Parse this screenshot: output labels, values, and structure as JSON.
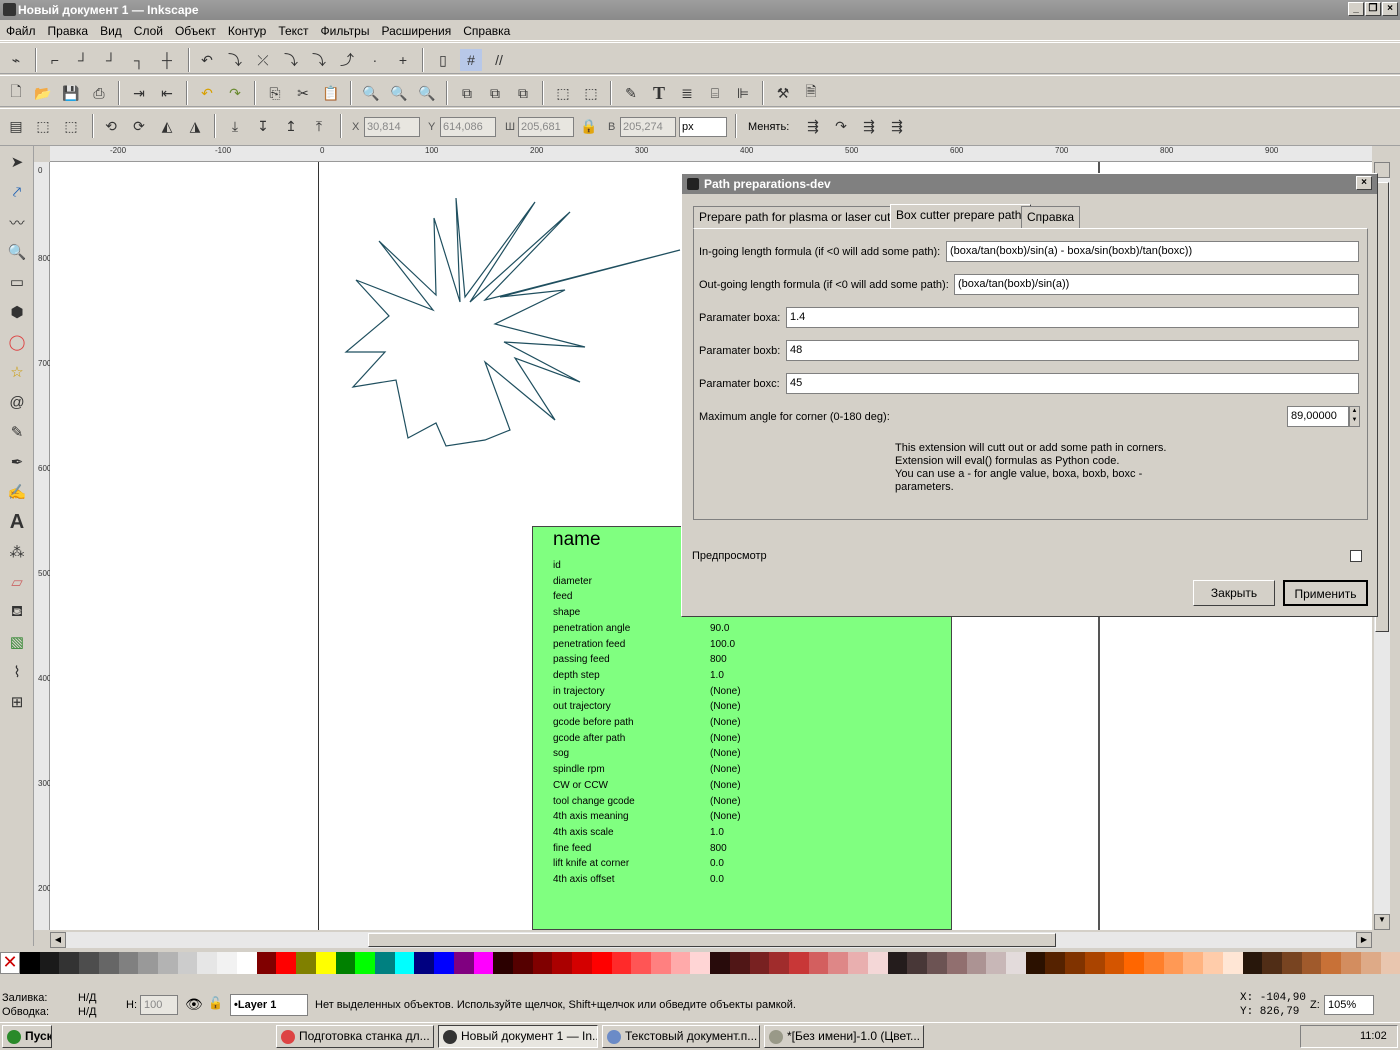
{
  "window": {
    "title": "Новый документ 1 — Inkscape"
  },
  "menu": [
    "Файл",
    "Правка",
    "Вид",
    "Слой",
    "Объект",
    "Контур",
    "Текст",
    "Фильтры",
    "Расширения",
    "Справка"
  ],
  "toolcontrols": {
    "x_label": "X",
    "x": "30,814",
    "y_label": "Y",
    "y": "614,086",
    "w_label": "Ш",
    "w": "205,681",
    "h_label": "В",
    "h": "205,274",
    "unit": "px",
    "change_label": "Менять:"
  },
  "ruler_h": [
    "-200",
    "-100",
    "0",
    "100",
    "200",
    "300",
    "400",
    "500",
    "600",
    "700",
    "800",
    "900"
  ],
  "ruler_v": [
    "0",
    "800",
    "700",
    "600",
    "500",
    "400",
    "300",
    "200"
  ],
  "green": {
    "title": "name",
    "rows": [
      {
        "k": "id",
        "v": ""
      },
      {
        "k": "diameter",
        "v": ""
      },
      {
        "k": "feed",
        "v": ""
      },
      {
        "k": "shape",
        "v": ""
      },
      {
        "k": "penetration angle",
        "v": "90.0"
      },
      {
        "k": "penetration feed",
        "v": "100.0"
      },
      {
        "k": "passing feed",
        "v": "800"
      },
      {
        "k": "depth step",
        "v": "1.0"
      },
      {
        "k": "in trajectory",
        "v": "(None)"
      },
      {
        "k": "out trajectory",
        "v": "(None)"
      },
      {
        "k": "gcode before path",
        "v": "(None)"
      },
      {
        "k": "gcode after path",
        "v": "(None)"
      },
      {
        "k": "sog",
        "v": "(None)"
      },
      {
        "k": "spindle rpm",
        "v": "(None)"
      },
      {
        "k": "CW or CCW",
        "v": "(None)"
      },
      {
        "k": "tool change gcode",
        "v": "(None)"
      },
      {
        "k": "4th axis meaning",
        "v": "(None)"
      },
      {
        "k": "4th axis scale",
        "v": "1.0"
      },
      {
        "k": "fine feed",
        "v": "800"
      },
      {
        "k": "lift knife at corner",
        "v": "0.0"
      },
      {
        "k": "4th axis offset",
        "v": "0.0"
      }
    ]
  },
  "dialog": {
    "title": "Path preparations-dev",
    "tabs": [
      "Prepare path for plasma or laser cuters",
      "Box cutter prepare path.",
      "Справка"
    ],
    "ingoing_label": "In-going length formula (if <0 will add some path):",
    "ingoing_value": "(boxa/tan(boxb)/sin(a) - boxa/sin(boxb)/tan(boxc))",
    "outgoing_label": "Out-going length formula (if <0 will add some path):",
    "outgoing_value": "(boxa/tan(boxb)/sin(a))",
    "boxa_label": "Paramater boxa:",
    "boxa_value": "1.4",
    "boxb_label": "Paramater boxb:",
    "boxb_value": "48",
    "boxc_label": "Paramater boxc:",
    "boxc_value": "45",
    "angle_label": "Maximum angle for corner (0-180 deg):",
    "angle_value": "89,00000",
    "help1": "This extension will cutt out or add some path in corners.",
    "help2": "Extension will eval() formulas as Python code.",
    "help3": "You can use a - for angle value, boxa, boxb, boxc -",
    "help4": "parameters.",
    "preview_label": "Предпросмотр",
    "close_label": "Закрыть",
    "apply_label": "Применить"
  },
  "palette": [
    "#000000",
    "#1a1a1a",
    "#333333",
    "#4d4d4d",
    "#666666",
    "#808080",
    "#999999",
    "#b3b3b3",
    "#cccccc",
    "#e6e6e6",
    "#f2f2f2",
    "#ffffff",
    "#800000",
    "#ff0000",
    "#808000",
    "#ffff00",
    "#008000",
    "#00ff00",
    "#008080",
    "#00ffff",
    "#000080",
    "#0000ff",
    "#800080",
    "#ff00ff",
    "#2b0000",
    "#550000",
    "#800000",
    "#aa0000",
    "#d40000",
    "#ff0000",
    "#ff2a2a",
    "#ff5555",
    "#ff8080",
    "#ffaaaa",
    "#ffd5d5",
    "#280b0b",
    "#501616",
    "#782121",
    "#a02c2c",
    "#c83737",
    "#d35f5f",
    "#de8787",
    "#e9afaf",
    "#f4d7d7",
    "#241c1c",
    "#483737",
    "#6c5353",
    "#916f6f",
    "#ac9393",
    "#c8b7b7",
    "#e3dbdb",
    "#2b1100",
    "#552200",
    "#803300",
    "#aa4400",
    "#d45500",
    "#ff6600",
    "#ff7f2a",
    "#ff9955",
    "#ffb380",
    "#ffccaa",
    "#ffe6d5",
    "#28170b",
    "#502d16",
    "#784421",
    "#a05a2c",
    "#c87137",
    "#d38d5f",
    "#deaa87",
    "#e9c6af"
  ],
  "status": {
    "fill_label": "Заливка:",
    "fill": "Н/Д",
    "stroke_label": "Обводка:",
    "stroke": "Н/Д",
    "h_label": "H:",
    "opacity": "100",
    "layer": "•Layer 1",
    "message": "Нет выделенных объектов. Используйте щелчок, Shift+щелчок или обведите объекты рамкой.",
    "x": "X: -104,90",
    "y": "Y:  826,79",
    "z_label": "Z:",
    "zoom": "105%"
  },
  "taskbar": {
    "start": "Пуск",
    "tasks": [
      "Подготовка станка дл...",
      "Новый документ 1 — In...",
      "Текстовый документ.п...",
      "*[Без имени]-1.0 (Цвет..."
    ],
    "clock": "11:02"
  }
}
